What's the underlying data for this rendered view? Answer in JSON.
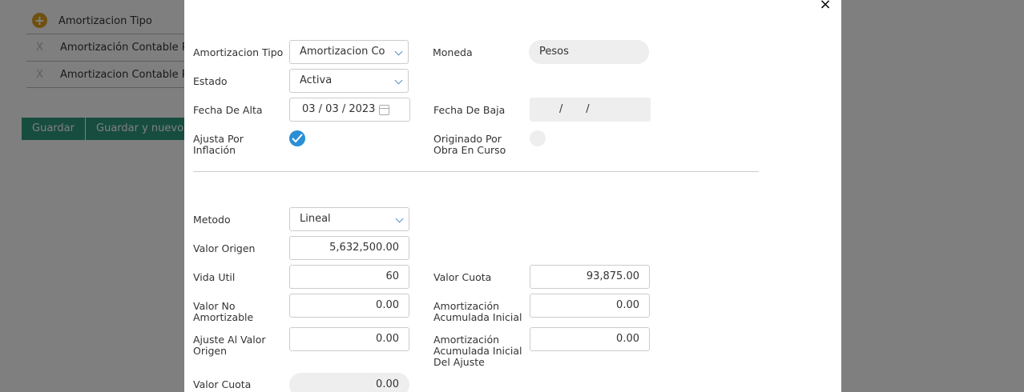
{
  "background": {
    "header_label": "Amortizacion Tipo",
    "add_icon": "plus-circle-icon",
    "rows": [
      {
        "remove_icon": "X",
        "label": "Amortización Contable Pesos"
      },
      {
        "remove_icon": "X",
        "label": "Amortizacion Contable Pesos"
      }
    ],
    "buttons": {
      "save": "Guardar",
      "save_new": "Guardar y nuevo"
    }
  },
  "modal": {
    "close_icon": "×",
    "amortizacion_tipo": {
      "label": "Amortizacion Tipo",
      "value": "Amortizacion Co"
    },
    "moneda": {
      "label": "Moneda",
      "value": "Pesos"
    },
    "estado": {
      "label": "Estado",
      "value": "Activa"
    },
    "fecha_alta": {
      "label": "Fecha De Alta",
      "value": "03 / 03 / 2023"
    },
    "fecha_baja": {
      "label": "Fecha De Baja",
      "value": "/       /"
    },
    "ajusta_inflacion": {
      "label_1": "Ajusta Por",
      "label_2": "Inflación",
      "checked": true
    },
    "obra_en_curso": {
      "label_1": "Originado Por",
      "label_2": "Obra En Curso",
      "checked": false
    },
    "metodo": {
      "label": "Metodo",
      "value": "Lineal"
    },
    "valor_origen": {
      "label": "Valor Origen",
      "value": "5,632,500.00"
    },
    "vida_util": {
      "label": "Vida Util",
      "value": "60"
    },
    "valor_cuota": {
      "label": "Valor Cuota",
      "value": "93,875.00"
    },
    "valor_no_amortizable": {
      "label_1": "Valor No",
      "label_2": "Amortizable",
      "value": "0.00"
    },
    "amort_acum_inicial": {
      "label_1": "Amortización",
      "label_2": "Acumulada Inicial",
      "value": "0.00"
    },
    "ajuste_valor_origen": {
      "label_1": "Ajuste Al Valor",
      "label_2": "Origen",
      "value": "0.00"
    },
    "amort_acum_inicial_ajuste": {
      "label_1": "Amortización",
      "label_2": "Acumulada Inicial",
      "label_3": "Del Ajuste",
      "value": "0.00"
    },
    "valor_cuota_2": {
      "label": "Valor Cuota",
      "value": "0.00"
    }
  }
}
